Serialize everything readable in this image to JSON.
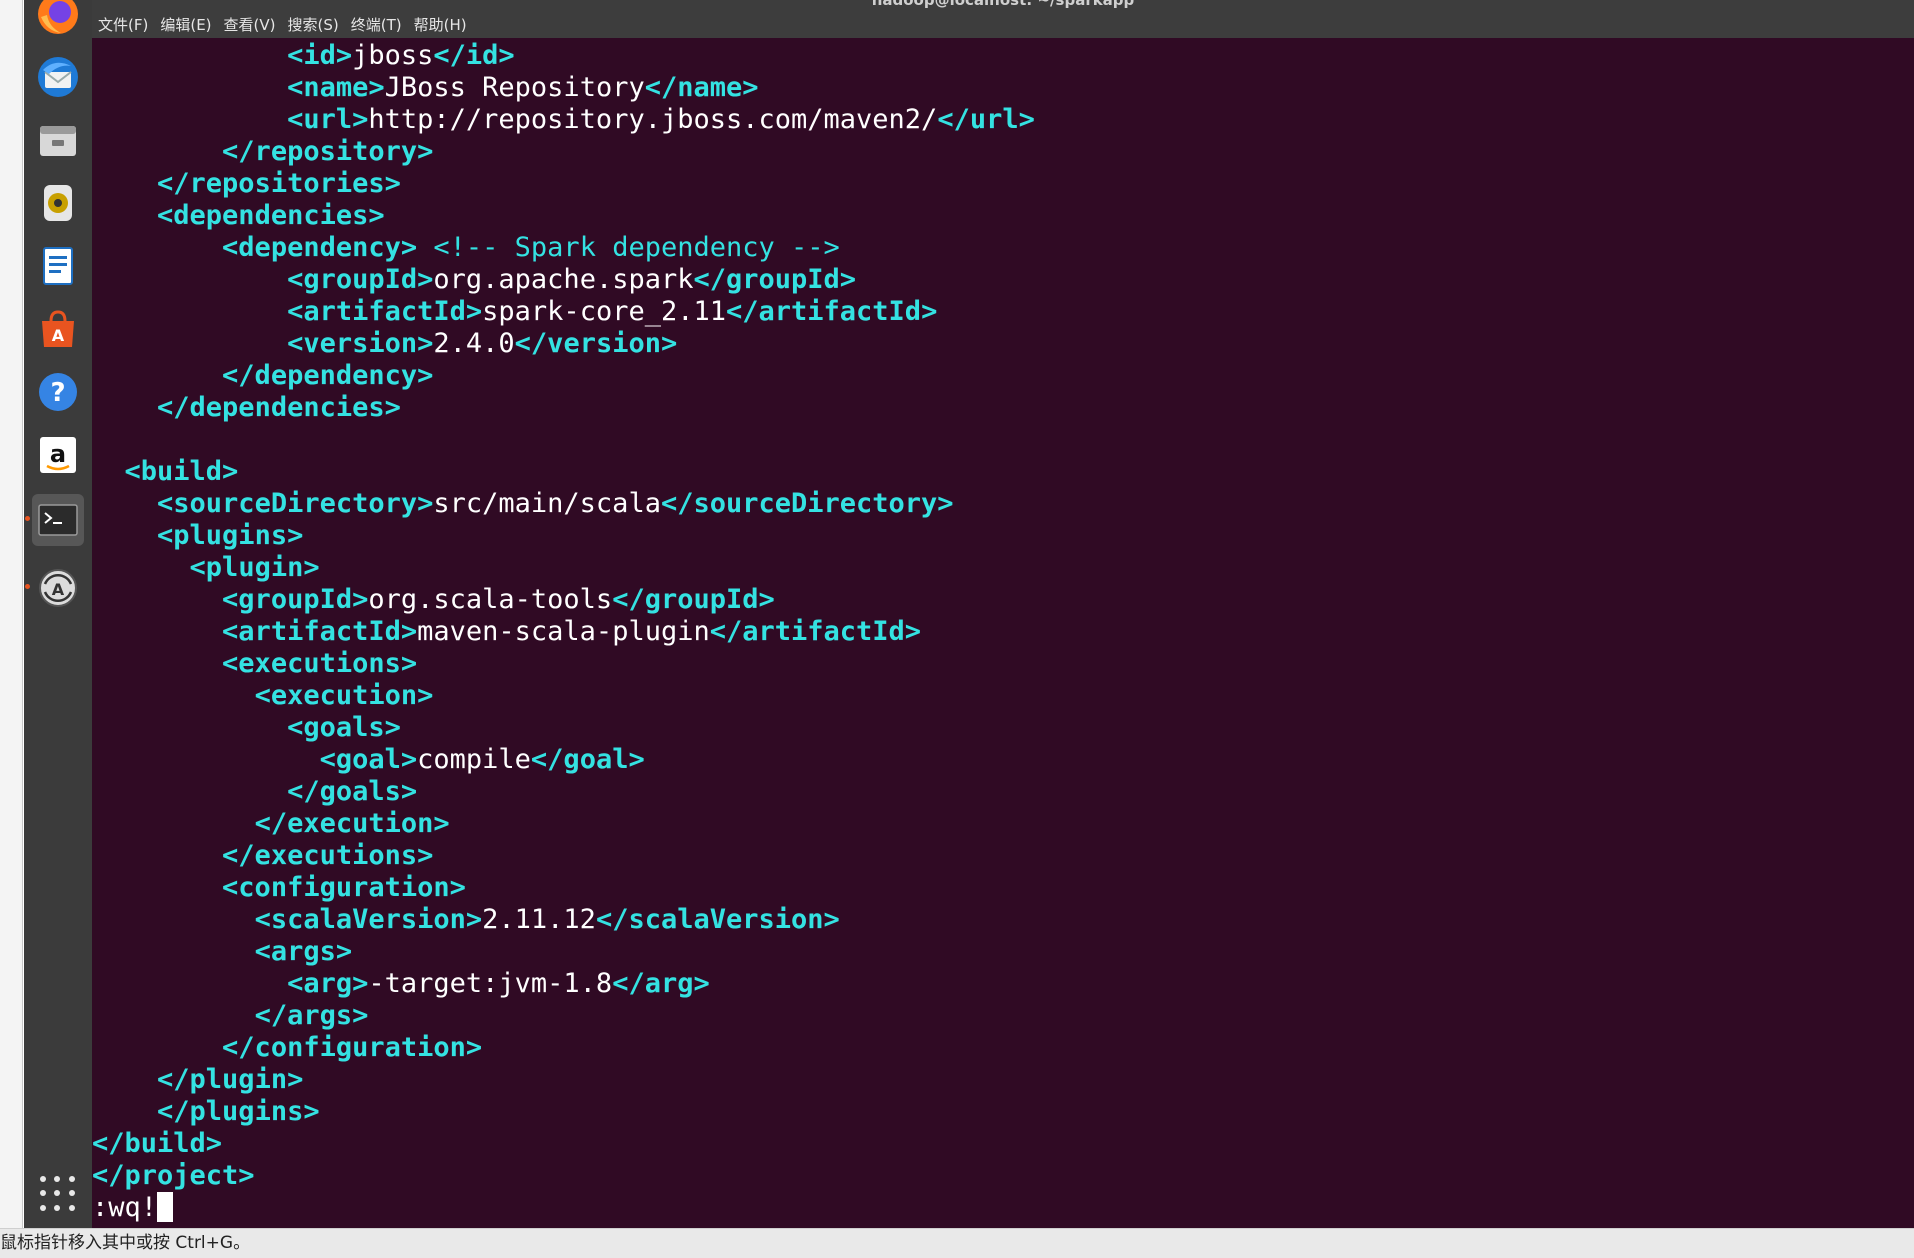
{
  "window": {
    "title": "hadoop@localhost: ~/sparkapp"
  },
  "menu": [
    "文件(F)",
    "编辑(E)",
    "查看(V)",
    "搜索(S)",
    "终端(T)",
    "帮助(H)"
  ],
  "dock": [
    {
      "name": "firefox-icon",
      "active": false
    },
    {
      "name": "thunderbird-icon",
      "active": false
    },
    {
      "name": "files-icon",
      "active": false
    },
    {
      "name": "rhythmbox-icon",
      "active": false
    },
    {
      "name": "writer-icon",
      "active": false
    },
    {
      "name": "software-center-icon",
      "active": false
    },
    {
      "name": "help-icon",
      "active": false
    },
    {
      "name": "amazon-icon",
      "active": false
    },
    {
      "name": "terminal-icon",
      "active": true
    },
    {
      "name": "software-updater-icon",
      "active": false
    }
  ],
  "code_lines": [
    [
      [
        "t",
        "            "
      ],
      [
        "g",
        "<id>"
      ],
      [
        "t",
        "jboss"
      ],
      [
        "g",
        "</id>"
      ]
    ],
    [
      [
        "t",
        "            "
      ],
      [
        "g",
        "<name>"
      ],
      [
        "t",
        "JBoss Repository"
      ],
      [
        "g",
        "</name>"
      ]
    ],
    [
      [
        "t",
        "            "
      ],
      [
        "g",
        "<url>"
      ],
      [
        "t",
        "http://repository.jboss.com/maven2/"
      ],
      [
        "g",
        "</url>"
      ]
    ],
    [
      [
        "t",
        "        "
      ],
      [
        "g",
        "</repository>"
      ]
    ],
    [
      [
        "t",
        "    "
      ],
      [
        "g",
        "</repositories>"
      ]
    ],
    [
      [
        "t",
        "    "
      ],
      [
        "g",
        "<dependencies>"
      ]
    ],
    [
      [
        "t",
        "        "
      ],
      [
        "g",
        "<dependency>"
      ],
      [
        "t",
        " "
      ],
      [
        "c",
        "<!-- Spark dependency -->"
      ]
    ],
    [
      [
        "t",
        "            "
      ],
      [
        "g",
        "<groupId>"
      ],
      [
        "t",
        "org.apache.spark"
      ],
      [
        "g",
        "</groupId>"
      ]
    ],
    [
      [
        "t",
        "            "
      ],
      [
        "g",
        "<artifactId>"
      ],
      [
        "t",
        "spark-core_2.11"
      ],
      [
        "g",
        "</artifactId>"
      ]
    ],
    [
      [
        "t",
        "            "
      ],
      [
        "g",
        "<version>"
      ],
      [
        "t",
        "2.4.0"
      ],
      [
        "g",
        "</version>"
      ]
    ],
    [
      [
        "t",
        "        "
      ],
      [
        "g",
        "</dependency>"
      ]
    ],
    [
      [
        "t",
        "    "
      ],
      [
        "g",
        "</dependencies>"
      ]
    ],
    [
      [
        "t",
        ""
      ]
    ],
    [
      [
        "t",
        "  "
      ],
      [
        "g",
        "<build>"
      ]
    ],
    [
      [
        "t",
        "    "
      ],
      [
        "g",
        "<sourceDirectory>"
      ],
      [
        "t",
        "src/main/scala"
      ],
      [
        "g",
        "</sourceDirectory>"
      ]
    ],
    [
      [
        "t",
        "    "
      ],
      [
        "g",
        "<plugins>"
      ]
    ],
    [
      [
        "t",
        "      "
      ],
      [
        "g",
        "<plugin>"
      ]
    ],
    [
      [
        "t",
        "        "
      ],
      [
        "g",
        "<groupId>"
      ],
      [
        "t",
        "org.scala-tools"
      ],
      [
        "g",
        "</groupId>"
      ]
    ],
    [
      [
        "t",
        "        "
      ],
      [
        "g",
        "<artifactId>"
      ],
      [
        "t",
        "maven-scala-plugin"
      ],
      [
        "g",
        "</artifactId>"
      ]
    ],
    [
      [
        "t",
        "        "
      ],
      [
        "g",
        "<executions>"
      ]
    ],
    [
      [
        "t",
        "          "
      ],
      [
        "g",
        "<execution>"
      ]
    ],
    [
      [
        "t",
        "            "
      ],
      [
        "g",
        "<goals>"
      ]
    ],
    [
      [
        "t",
        "              "
      ],
      [
        "g",
        "<goal>"
      ],
      [
        "t",
        "compile"
      ],
      [
        "g",
        "</goal>"
      ]
    ],
    [
      [
        "t",
        "            "
      ],
      [
        "g",
        "</goals>"
      ]
    ],
    [
      [
        "t",
        "          "
      ],
      [
        "g",
        "</execution>"
      ]
    ],
    [
      [
        "t",
        "        "
      ],
      [
        "g",
        "</executions>"
      ]
    ],
    [
      [
        "t",
        "        "
      ],
      [
        "g",
        "<configuration>"
      ]
    ],
    [
      [
        "t",
        "          "
      ],
      [
        "g",
        "<scalaVersion>"
      ],
      [
        "t",
        "2.11.12"
      ],
      [
        "g",
        "</scalaVersion>"
      ]
    ],
    [
      [
        "t",
        "          "
      ],
      [
        "g",
        "<args>"
      ]
    ],
    [
      [
        "t",
        "            "
      ],
      [
        "g",
        "<arg>"
      ],
      [
        "t",
        "-target:jvm-1.8"
      ],
      [
        "g",
        "</arg>"
      ]
    ],
    [
      [
        "t",
        "          "
      ],
      [
        "g",
        "</args>"
      ]
    ],
    [
      [
        "t",
        "        "
      ],
      [
        "g",
        "</configuration>"
      ]
    ],
    [
      [
        "t",
        "    "
      ],
      [
        "g",
        "</plugin>"
      ]
    ],
    [
      [
        "t",
        "    "
      ],
      [
        "g",
        "</plugins>"
      ]
    ],
    [
      [
        "g",
        "</build>"
      ]
    ],
    [
      [
        "g",
        "</project>"
      ]
    ]
  ],
  "command_line": ":wq!",
  "host_status": "鼠标指针移入其中或按 Ctrl+G。",
  "colors": {
    "terminal_bg": "#300a24",
    "tag": "#34e2e2",
    "text": "#ffffff",
    "dock_bg": "#3b3b3b"
  }
}
